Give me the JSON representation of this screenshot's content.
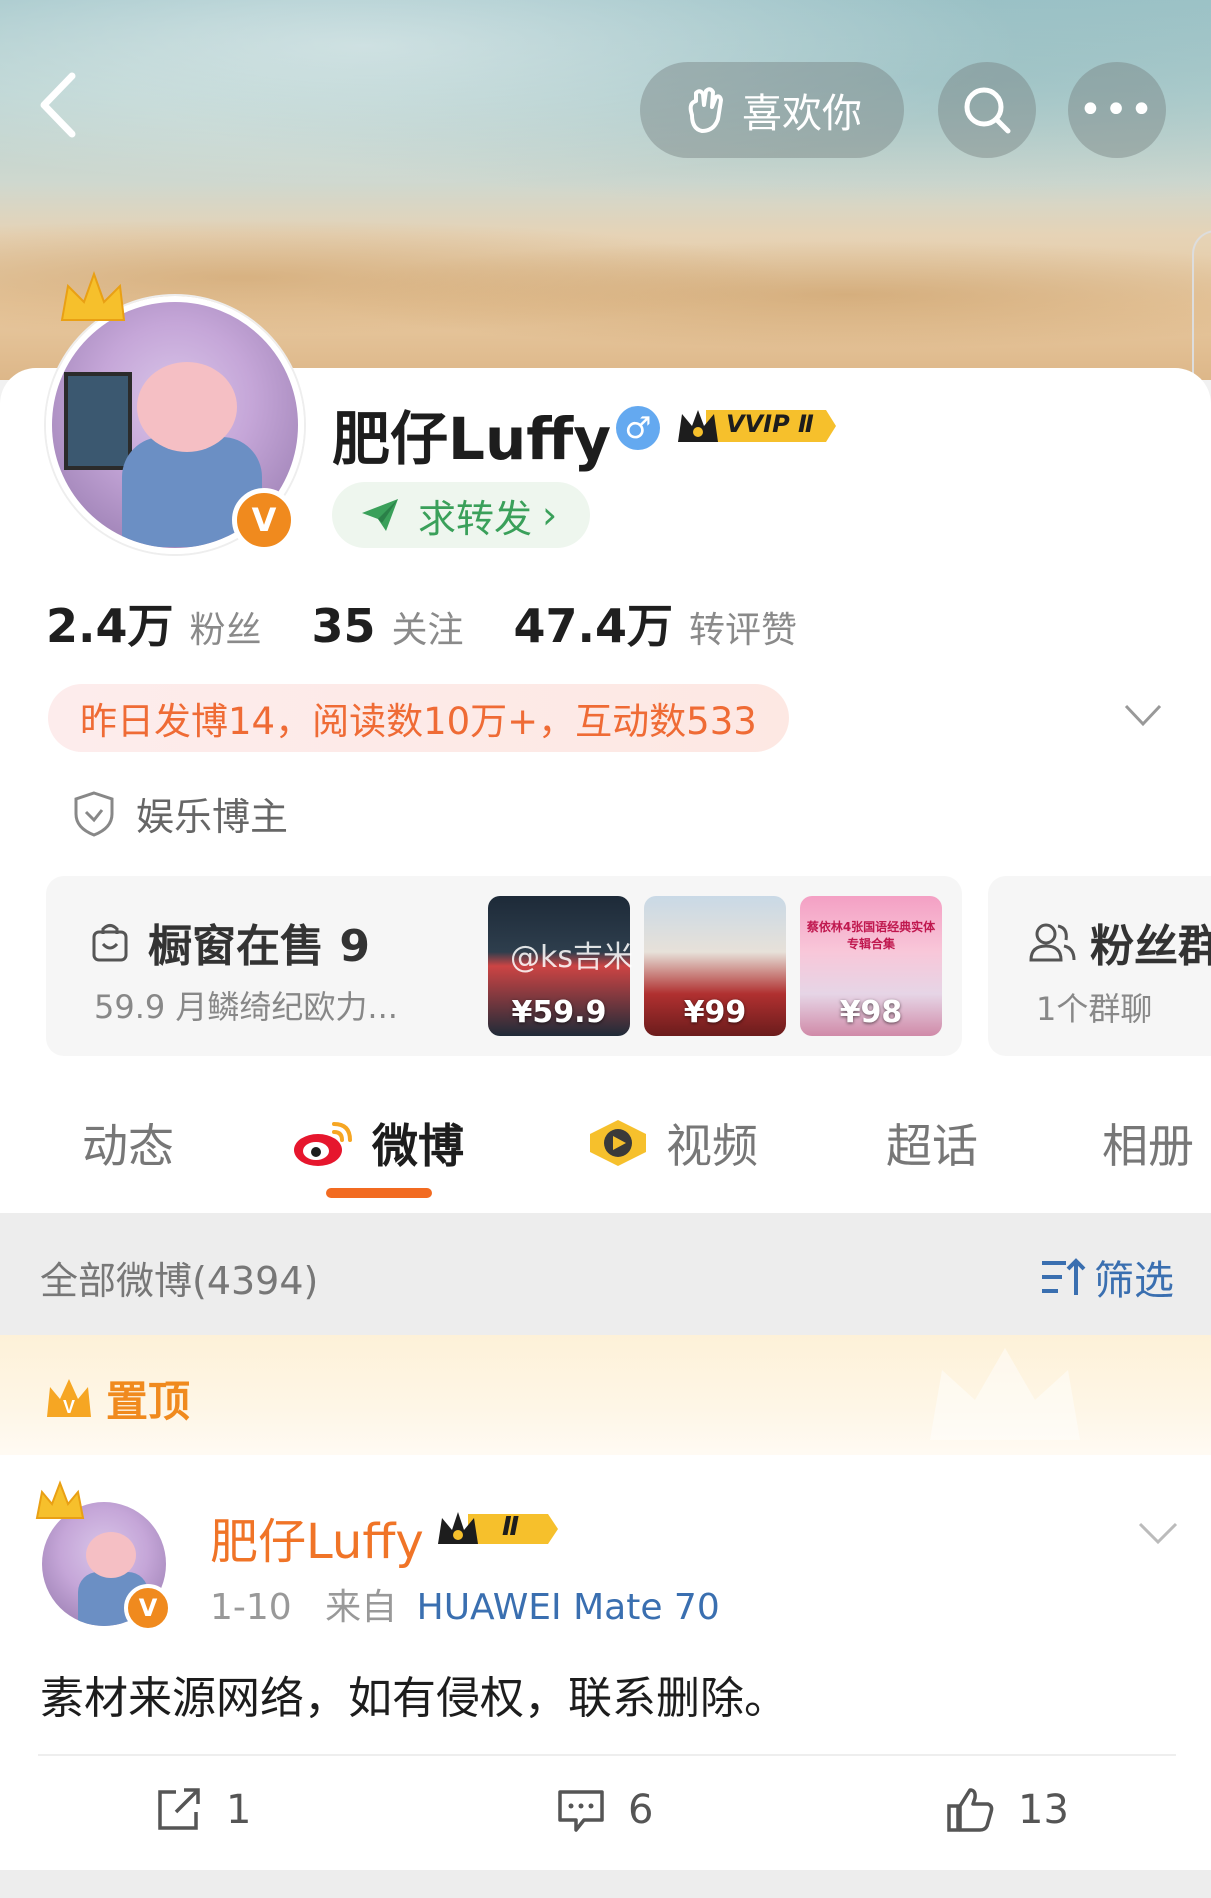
{
  "header": {
    "like_label": "喜欢你",
    "more_label": "•••"
  },
  "profile": {
    "name": "肥仔Luffy",
    "gender_symbol": "♂",
    "vip_badge": "VVIP Ⅱ",
    "verified_badge": "V",
    "forward_button": "求转发",
    "forward_chevron": "›",
    "stats": [
      {
        "value": "2.4万",
        "label": "粉丝"
      },
      {
        "value": "35",
        "label": "关注"
      },
      {
        "value": "47.4万",
        "label": "转评赞"
      }
    ],
    "activity": "昨日发博14，阅读数10万+，互动数533",
    "role": "娱乐博主"
  },
  "shop": {
    "title": "橱窗在售 9",
    "subtitle": "59.9 月鳞绮纪欧力...",
    "products": [
      {
        "price": "¥59.9"
      },
      {
        "price": "¥99"
      },
      {
        "price": "¥98",
        "caption": "蔡依林4张国语经典实体专辑合集"
      }
    ],
    "watermark": "@ks吉米"
  },
  "fans_group": {
    "title": "粉丝群",
    "subtitle": "1个群聊"
  },
  "tabs": [
    {
      "label": "动态",
      "active": false
    },
    {
      "label": "微博",
      "active": true
    },
    {
      "label": "视频",
      "active": false
    },
    {
      "label": "超话",
      "active": false
    },
    {
      "label": "相册",
      "active": false
    }
  ],
  "filter": {
    "count_label": "全部微博(4394)",
    "filter_label": "筛选"
  },
  "pinned": {
    "label": "置顶"
  },
  "post": {
    "author": "肥仔Luffy",
    "vip_level": "Ⅱ",
    "date": "1-10",
    "source_prefix": "来自",
    "device": "HUAWEI Mate 70",
    "text": "素材来源网络，如有侵权，联系删除。",
    "reposts": "1",
    "comments": "6",
    "likes": "13"
  },
  "colors": {
    "accent_orange": "#f26b21",
    "link_blue": "#3a6fb0",
    "activity_text": "#ef6b35"
  }
}
